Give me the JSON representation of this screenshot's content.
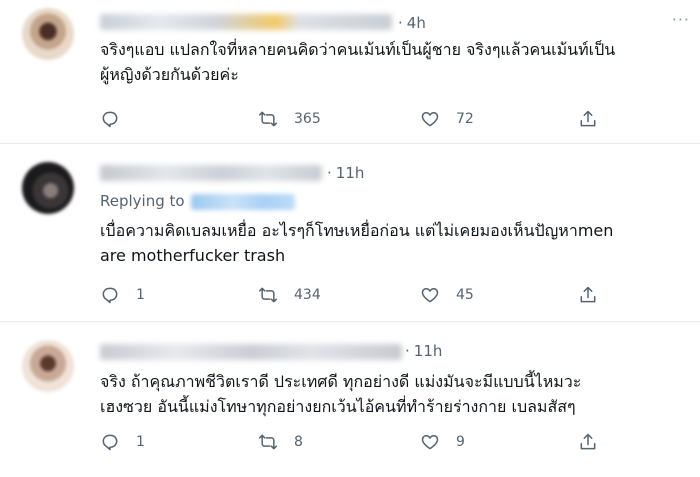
{
  "tweets": [
    {
      "time": "4h",
      "text": "จริงๆแอบ แปลกใจที่หลายคนคิดว่าคนเม้นท์เป็นผู้ชาย จริงๆแล้วคนเม้นท์เป็น\nผู้หญิงด้วยกันด้วยค่ะ",
      "replies": "",
      "retweets": "365",
      "likes": "72"
    },
    {
      "time": "11h",
      "replying_to_label": "Replying to",
      "text": "เบื่อความคิดเบลมเหยื่อ อะไรๆก็โทษเหยื่อก่อน แต่ไม่เคยมองเห็นปัญหาmen\nare motherfucker   trash",
      "replies": "1",
      "retweets": "434",
      "likes": "45"
    },
    {
      "time": "11h",
      "text": "จริง ถ้าคุณภาพชีวิตเราดี ประเทศดี ทุกอย่างดี แม่งมันจะมีแบบนี้ไหมวะ\nเฮงซวย อันนี้แม่งโทษาทุกอย่างยกเว้นไอ้คนที่ทำร้ายร่างกาย เบลมสัสๆ",
      "replies": "1",
      "retweets": "8",
      "likes": "9"
    }
  ],
  "icons": {
    "reply": "reply-icon",
    "retweet": "retweet-icon",
    "like": "heart-icon",
    "share": "share-icon",
    "more": "more-icon"
  },
  "colors": {
    "text": "#0f1419",
    "secondary": "#536471",
    "divider": "#e6ecf0",
    "link": "#1d9bf0"
  }
}
